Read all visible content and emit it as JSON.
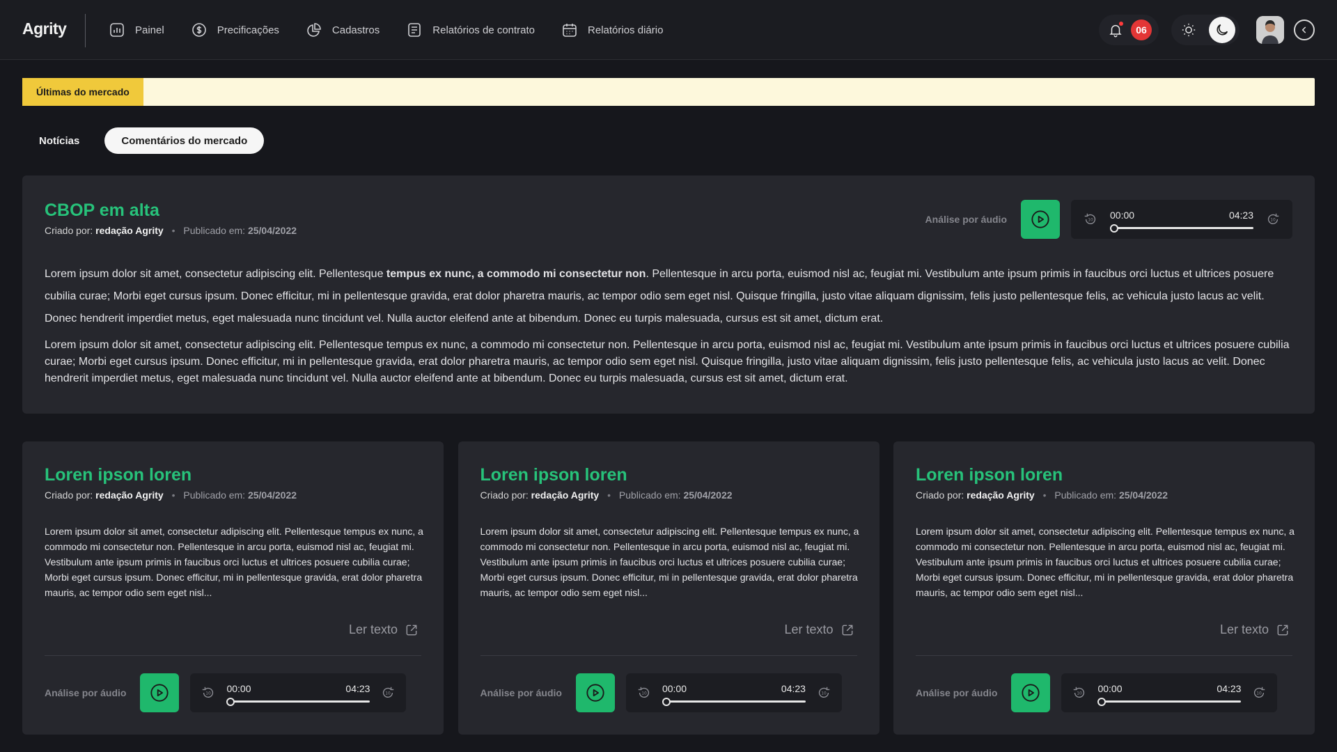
{
  "app": {
    "logo": "Agrity"
  },
  "nav": {
    "items": [
      {
        "label": "Painel",
        "icon": "chart-icon"
      },
      {
        "label": "Precificações",
        "icon": "dollar-icon"
      },
      {
        "label": "Cadastros",
        "icon": "pie-chart-icon"
      },
      {
        "label": "Relatórios de contrato",
        "icon": "document-icon"
      },
      {
        "label": "Relatórios diário",
        "icon": "calendar-icon"
      }
    ],
    "notification_count": "06"
  },
  "ticker": {
    "label": "Últimas do mercado"
  },
  "tabs": [
    {
      "label": "Notícias",
      "active": false
    },
    {
      "label": "Comentários do mercado",
      "active": true
    }
  ],
  "featured": {
    "title": "CBOP em alta",
    "created_by_label": "Criado por:",
    "author": "redação Agrity",
    "published_label": "Publicado em:",
    "date": "25/04/2022",
    "p1_a": "Lorem ipsum dolor sit amet, consectetur adipiscing elit. Pellentesque ",
    "p1_bold": "tempus ex nunc, a commodo mi consectetur non",
    "p1_b": ". Pellentesque in arcu porta, euismod nisl ac, feugiat mi. Vestibulum ante ipsum primis in faucibus orci luctus et ultrices posuere cubilia curae; Morbi eget cursus ipsum. Donec efficitur, mi in pellentesque gravida, erat dolor pharetra mauris, ac tempor odio sem eget nisl. Quisque fringilla, justo vitae aliquam dignissim, felis justo pellentesque felis, ac vehicula justo lacus ac velit. Donec hendrerit imperdiet metus, eget malesuada nunc tincidunt vel. Nulla auctor eleifend ante at bibendum. Donec eu turpis malesuada, cursus est sit amet, dictum erat.",
    "p2": "Lorem ipsum dolor sit amet, consectetur adipiscing elit. Pellentesque tempus ex nunc, a commodo mi consectetur non. Pellentesque in arcu porta, euismod nisl ac, feugiat mi. Vestibulum ante ipsum primis in faucibus orci luctus et ultrices posuere cubilia curae; Morbi eget cursus ipsum. Donec efficitur, mi in pellentesque gravida, erat dolor pharetra mauris, ac tempor odio sem eget nisl. Quisque fringilla, justo vitae aliquam dignissim, felis justo pellentesque felis, ac vehicula justo lacus ac velit. Donec hendrerit imperdiet metus, eget malesuada nunc tincidunt vel. Nulla auctor eleifend ante at bibendum. Donec eu turpis malesuada, cursus est sit amet, dictum erat.",
    "audio": {
      "label": "Análise por áudio",
      "current": "00:00",
      "duration": "04:23",
      "progress": 0
    }
  },
  "cards": [
    {
      "title": "Loren ipson loren",
      "created_by_label": "Criado por:",
      "author": "redação Agrity",
      "published_label": "Publicado em:",
      "date": "25/04/2022",
      "excerpt": "Lorem ipsum dolor sit amet, consectetur adipiscing elit. Pellentesque tempus ex nunc, a commodo mi consectetur non. Pellentesque in arcu porta, euismod nisl ac, feugiat mi. Vestibulum ante ipsum primis in faucibus orci luctus et ultrices posuere cubilia curae; Morbi eget cursus ipsum. Donec efficitur, mi in pellentesque gravida, erat dolor pharetra mauris, ac tempor odio sem eget nisl...",
      "read_label": "Ler texto",
      "audio": {
        "label": "Análise por áudio",
        "current": "00:00",
        "duration": "04:23",
        "progress": 0
      }
    },
    {
      "title": "Loren ipson loren",
      "created_by_label": "Criado por:",
      "author": "redação Agrity",
      "published_label": "Publicado em:",
      "date": "25/04/2022",
      "excerpt": "Lorem ipsum dolor sit amet, consectetur adipiscing elit. Pellentesque tempus ex nunc, a commodo mi consectetur non. Pellentesque in arcu porta, euismod nisl ac, feugiat mi. Vestibulum ante ipsum primis in faucibus orci luctus et ultrices posuere cubilia curae; Morbi eget cursus ipsum. Donec efficitur, mi in pellentesque gravida, erat dolor pharetra mauris, ac tempor odio sem eget nisl...",
      "read_label": "Ler texto",
      "audio": {
        "label": "Análise por áudio",
        "current": "00:00",
        "duration": "04:23",
        "progress": 0
      }
    },
    {
      "title": "Loren ipson loren",
      "created_by_label": "Criado por:",
      "author": "redação Agrity",
      "published_label": "Publicado em:",
      "date": "25/04/2022",
      "excerpt": "Lorem ipsum dolor sit amet, consectetur adipiscing elit. Pellentesque tempus ex nunc, a commodo mi consectetur non. Pellentesque in arcu porta, euismod nisl ac, feugiat mi. Vestibulum ante ipsum primis in faucibus orci luctus et ultrices posuere cubilia curae; Morbi eget cursus ipsum. Donec efficitur, mi in pellentesque gravida, erat dolor pharetra mauris, ac tempor odio sem eget nisl...",
      "read_label": "Ler texto",
      "audio": {
        "label": "Análise por áudio",
        "current": "00:00",
        "duration": "04:23",
        "progress": 0
      }
    }
  ],
  "colors": {
    "accent_green": "#1fb86c",
    "title_green": "#27c27a",
    "ticker_yellow": "#f0c93b",
    "badge_red": "#e33636",
    "background": "#16171c",
    "card": "#26272d"
  }
}
